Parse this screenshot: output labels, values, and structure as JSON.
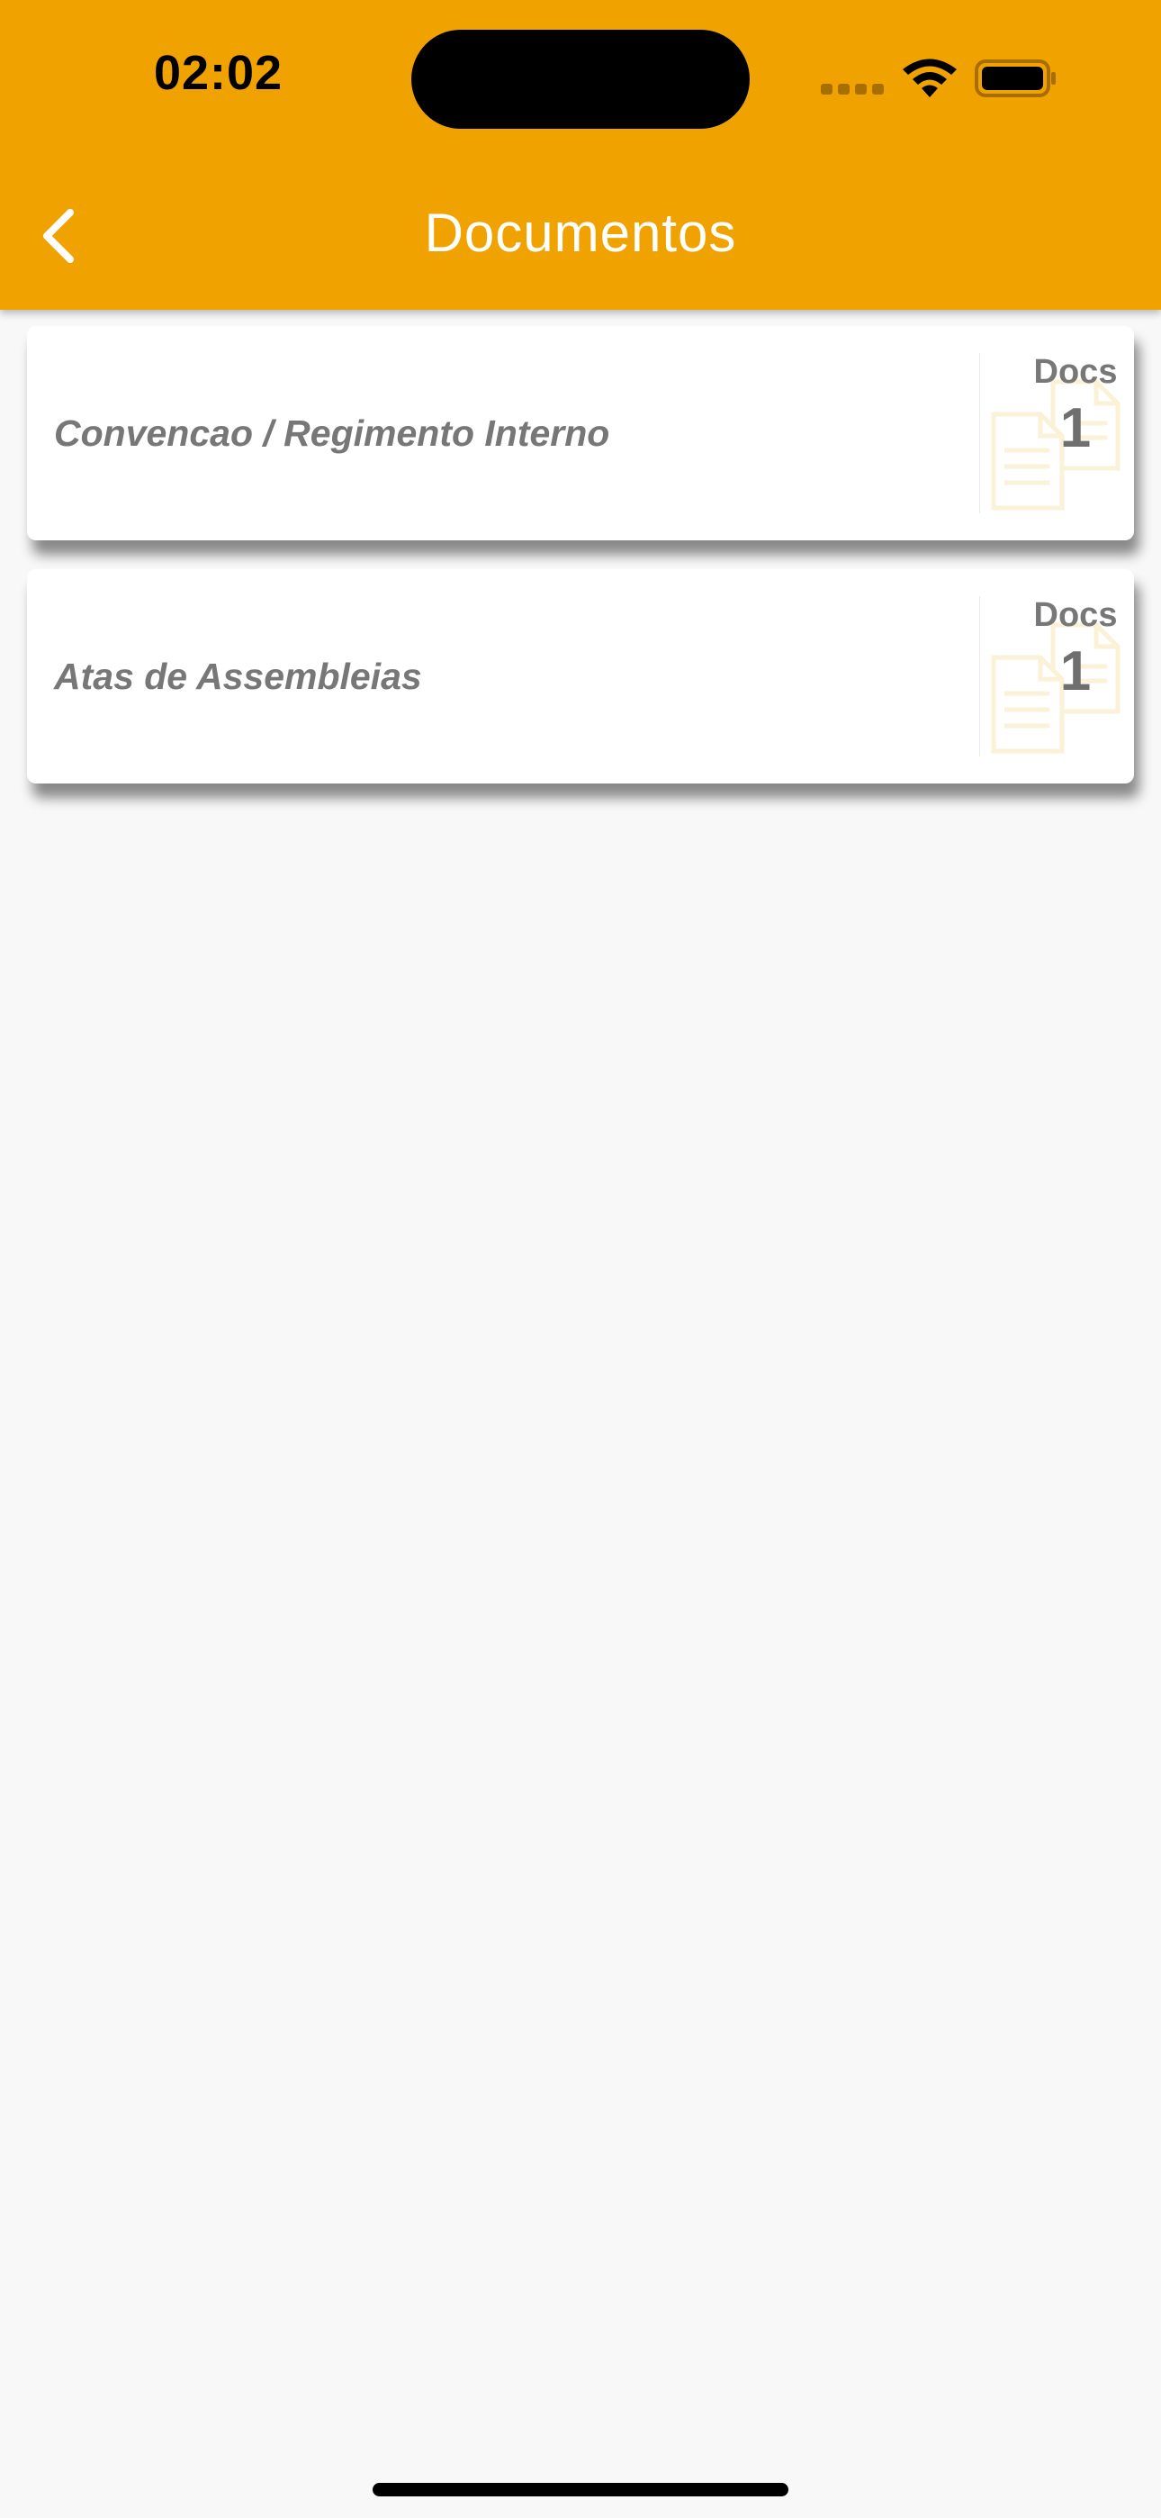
{
  "status_bar": {
    "time": "02:02"
  },
  "header": {
    "title": "Documentos",
    "back_icon": "chevron-left-icon"
  },
  "colors": {
    "header": "#f0a300",
    "card_text": "#777777",
    "background": "#f8f8f8"
  },
  "items": [
    {
      "label": "Convencao / Regimento Interno",
      "count_label": "Docs",
      "count": "1",
      "icon": "documents-icon"
    },
    {
      "label": "Atas de Assembleias",
      "count_label": "Docs",
      "count": "1",
      "icon": "documents-icon"
    }
  ]
}
